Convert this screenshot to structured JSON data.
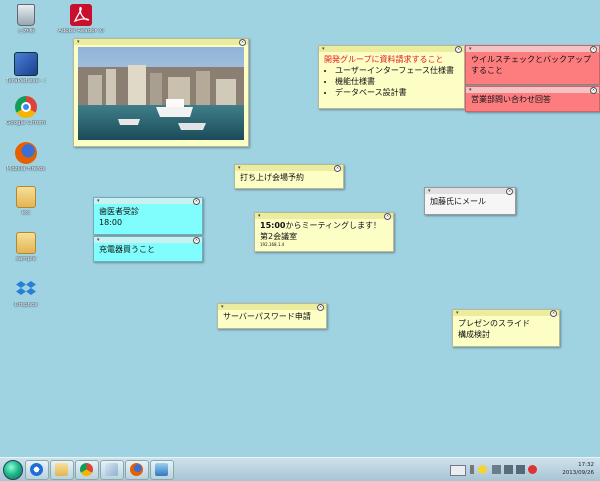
{
  "desktop_icons": [
    {
      "label": "ごみ箱",
      "icon": "recycle-bin-icon"
    },
    {
      "label": "Adobe Reader XI",
      "icon": "adobe-reader-icon"
    },
    {
      "label": "TeraPad.exe - ショートカット",
      "icon": "terapad-icon"
    },
    {
      "label": "Google Chrome",
      "icon": "chrome-icon"
    },
    {
      "label": "Mozilla Firefox",
      "icon": "firefox-icon"
    },
    {
      "label": "etc",
      "icon": "folder-icon"
    },
    {
      "label": "sample",
      "icon": "folder-icon"
    },
    {
      "label": "Dropbox",
      "icon": "dropbox-icon"
    }
  ],
  "notes": {
    "photo_note": {
      "alt": "港の写真"
    },
    "dev_group": {
      "title": "開発グループに資料請求すること",
      "items": [
        "ユーザーインターフェース仕様書",
        "機能仕様書",
        "データベース設計書"
      ]
    },
    "virus_check": {
      "text": "ウイルスチェックとバックアップすること"
    },
    "sales_inquiry": {
      "text": "営業部問い合わせ回答"
    },
    "party": {
      "text": "打ち上げ会場予約"
    },
    "mail": {
      "text": "加藤氏にメール"
    },
    "dentist": {
      "line1": "歯医者受診",
      "line2": "18:00"
    },
    "charger": {
      "text": "充電器買うこと"
    },
    "meeting": {
      "line1_bold": "15:00",
      "line1_rest": "からミーティングします！",
      "line2": "第2会議室",
      "line3": "192.168.1.4"
    },
    "server_pw": {
      "text": "サーバーパスワード申請"
    },
    "presentation": {
      "line1": "プレゼンのスライド",
      "line2": "構成検討"
    }
  },
  "taskbar": {
    "items": [
      "ie-icon",
      "explorer-icon",
      "chrome-icon",
      "app-icon",
      "firefox-icon",
      "remote-desktop-icon"
    ],
    "clock_time": "17:32",
    "clock_date": "2013/09/26"
  },
  "colors": {
    "desktop": "#9fd3e2",
    "note_yellow": "#fdfdc6",
    "note_cyan": "#80fdfd",
    "note_red": "#fd7d7f",
    "accent_red_text": "#e02020"
  }
}
